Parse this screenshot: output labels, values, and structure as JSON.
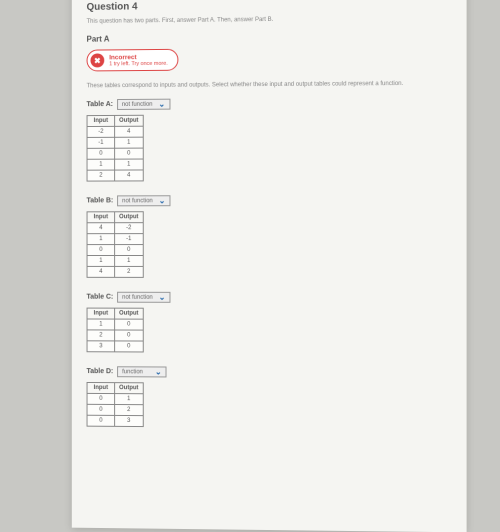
{
  "question": {
    "title": "Question 4",
    "instructions": "This question has two parts. First, answer Part A. Then, answer Part B.",
    "partLabel": "Part A",
    "incorrect": {
      "label": "Incorrect",
      "sub": "1 try left. Try once more."
    },
    "prompt": "These tables correspond to inputs and outputs. Select whether these input and output tables could represent a function."
  },
  "tables": {
    "a": {
      "label": "Table A:",
      "dropdown": "not function",
      "headers": [
        "Input",
        "Output"
      ],
      "rows": [
        [
          "-2",
          "4"
        ],
        [
          "-1",
          "1"
        ],
        [
          "0",
          "0"
        ],
        [
          "1",
          "1"
        ],
        [
          "2",
          "4"
        ]
      ]
    },
    "b": {
      "label": "Table B:",
      "dropdown": "not function",
      "headers": [
        "Input",
        "Output"
      ],
      "rows": [
        [
          "4",
          "-2"
        ],
        [
          "1",
          "-1"
        ],
        [
          "0",
          "0"
        ],
        [
          "1",
          "1"
        ],
        [
          "4",
          "2"
        ]
      ]
    },
    "c": {
      "label": "Table C:",
      "dropdown": "not function",
      "headers": [
        "Input",
        "Output"
      ],
      "rows": [
        [
          "1",
          "0"
        ],
        [
          "2",
          "0"
        ],
        [
          "3",
          "0"
        ]
      ]
    },
    "d": {
      "label": "Table D:",
      "dropdown": "function",
      "headers": [
        "Input",
        "Output"
      ],
      "rows": [
        [
          "0",
          "1"
        ],
        [
          "0",
          "2"
        ],
        [
          "0",
          "3"
        ]
      ]
    }
  }
}
